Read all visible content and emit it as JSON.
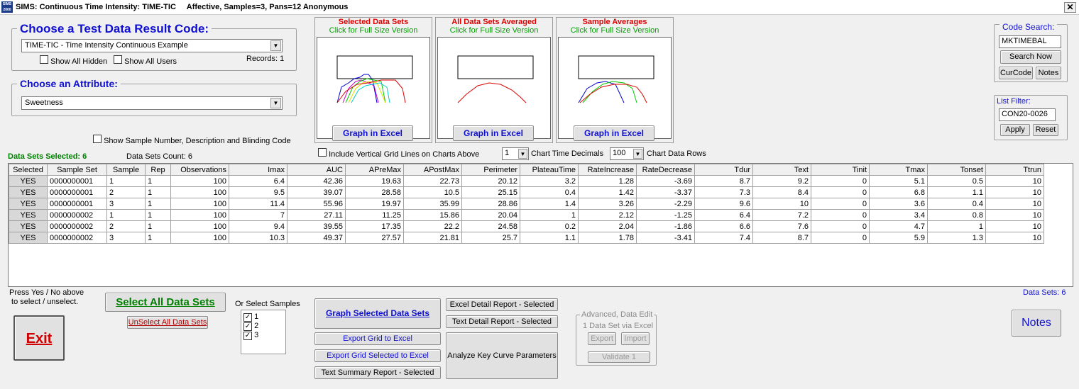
{
  "window": {
    "title": "SIMS: Continuous Time Intensity: TIME-TIC     Affective, Samples=3, Pans=12 Anonymous",
    "close": "✕"
  },
  "test_code": {
    "label": "Choose a Test Data Result Code:",
    "value": "TIME-TIC  - Time Intensity Continuous Example",
    "show_hidden": "Show All Hidden",
    "show_users": "Show All Users",
    "records": "Records: 1"
  },
  "attribute": {
    "label": "Choose an Attribute:",
    "value": "Sweetness"
  },
  "show_sample_cb": "Show Sample Number, Description and Blinding Code",
  "charts": [
    {
      "title": "Selected Data Sets",
      "sub": "Click for Full Size Version",
      "button": "Graph in Excel"
    },
    {
      "title": "All Data Sets Averaged",
      "sub": "Click for Full Size Version",
      "button": "Graph in Excel"
    },
    {
      "title": "Sample Averages",
      "sub": "Click for Full Size Version",
      "button": "Graph in Excel"
    }
  ],
  "code_search": {
    "label": "Code Search:",
    "value": "MKTIMEBAL",
    "search": "Search Now",
    "curcode": "CurCode",
    "notes": "Notes"
  },
  "list_filter": {
    "label": "List Filter:",
    "value": "CON20-0026",
    "apply": "Apply",
    "reset": "Reset"
  },
  "options": {
    "data_sets_selected": "Data Sets Selected: 6",
    "data_sets_count": "Data Sets Count: 6",
    "vgrid": "Include Vertical Grid Lines on Charts Above",
    "time_decimals_val": "1",
    "time_decimals": "Chart Time Decimals",
    "data_rows_val": "100",
    "data_rows": "Chart Data Rows"
  },
  "table": {
    "columns": [
      "Selected",
      "Sample Set",
      "Sample",
      "Rep",
      "Observations",
      "Imax",
      "AUC",
      "APreMax",
      "APostMax",
      "Perimeter",
      "PlateauTime",
      "RateIncrease",
      "RateDecrease",
      "Tdur",
      "Text",
      "Tinit",
      "Tmax",
      "Tonset",
      "Ttrun"
    ],
    "rows": [
      [
        "YES",
        "0000000001",
        "1",
        "1",
        "100",
        "6.4",
        "42.36",
        "19.63",
        "22.73",
        "20.12",
        "3.2",
        "1.28",
        "-3.69",
        "8.7",
        "9.2",
        "0",
        "5.1",
        "0.5",
        "10"
      ],
      [
        "YES",
        "0000000001",
        "2",
        "1",
        "100",
        "9.5",
        "39.07",
        "28.58",
        "10.5",
        "25.15",
        "0.4",
        "1.42",
        "-3.37",
        "7.3",
        "8.4",
        "0",
        "6.8",
        "1.1",
        "10"
      ],
      [
        "YES",
        "0000000001",
        "3",
        "1",
        "100",
        "11.4",
        "55.96",
        "19.97",
        "35.99",
        "28.86",
        "1.4",
        "3.26",
        "-2.29",
        "9.6",
        "10",
        "0",
        "3.6",
        "0.4",
        "10"
      ],
      [
        "YES",
        "0000000002",
        "1",
        "1",
        "100",
        "7",
        "27.11",
        "11.25",
        "15.86",
        "20.04",
        "1",
        "2.12",
        "-1.25",
        "6.4",
        "7.2",
        "0",
        "3.4",
        "0.8",
        "10"
      ],
      [
        "YES",
        "0000000002",
        "2",
        "1",
        "100",
        "9.4",
        "39.55",
        "17.35",
        "22.2",
        "24.58",
        "0.2",
        "2.04",
        "-1.86",
        "6.6",
        "7.6",
        "0",
        "4.7",
        "1",
        "10"
      ],
      [
        "YES",
        "0000000002",
        "3",
        "1",
        "100",
        "10.3",
        "49.37",
        "27.57",
        "21.81",
        "25.7",
        "1.1",
        "1.78",
        "-3.41",
        "7.4",
        "8.7",
        "0",
        "5.9",
        "1.3",
        "10"
      ]
    ]
  },
  "bottom": {
    "press_hint": "Press Yes / No above\n to select / unselect.",
    "select_all": "Select All Data Sets",
    "unselect_all": "UnSelect All Data Sets",
    "exit": "Exit",
    "or_select": "Or Select Samples",
    "samples": [
      "1",
      "2",
      "3"
    ],
    "graph_selected": "Graph Selected Data Sets",
    "export_grid": "Export Grid to Excel",
    "export_grid_sel": "Export Grid Selected to Excel",
    "text_summary": "Text Summary Report - Selected",
    "excel_detail": "Excel Detail Report - Selected",
    "text_detail": "Text Detail Report - Selected",
    "analyze": "Analyze Key Curve Parameters",
    "advanced": "Advanced, Data Edit",
    "adv_sub": "1 Data Set via Excel",
    "export": "Export",
    "import": "Import",
    "validate": "Validate 1",
    "data_sets": "Data Sets: 6",
    "notes": "Notes"
  }
}
